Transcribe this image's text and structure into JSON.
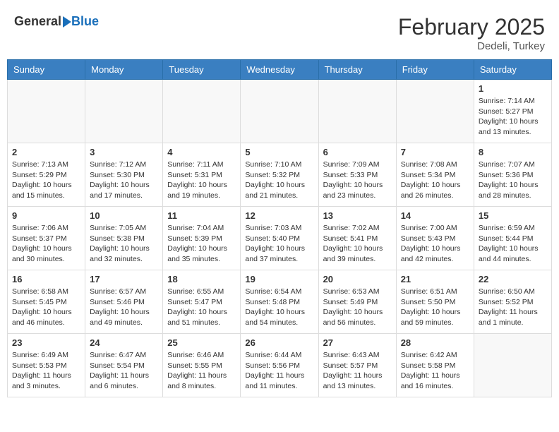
{
  "header": {
    "logo_general": "General",
    "logo_blue": "Blue",
    "month_title": "February 2025",
    "location": "Dedeli, Turkey"
  },
  "days_of_week": [
    "Sunday",
    "Monday",
    "Tuesday",
    "Wednesday",
    "Thursday",
    "Friday",
    "Saturday"
  ],
  "weeks": [
    [
      {
        "day": "",
        "info": ""
      },
      {
        "day": "",
        "info": ""
      },
      {
        "day": "",
        "info": ""
      },
      {
        "day": "",
        "info": ""
      },
      {
        "day": "",
        "info": ""
      },
      {
        "day": "",
        "info": ""
      },
      {
        "day": "1",
        "info": "Sunrise: 7:14 AM\nSunset: 5:27 PM\nDaylight: 10 hours\nand 13 minutes."
      }
    ],
    [
      {
        "day": "2",
        "info": "Sunrise: 7:13 AM\nSunset: 5:29 PM\nDaylight: 10 hours\nand 15 minutes."
      },
      {
        "day": "3",
        "info": "Sunrise: 7:12 AM\nSunset: 5:30 PM\nDaylight: 10 hours\nand 17 minutes."
      },
      {
        "day": "4",
        "info": "Sunrise: 7:11 AM\nSunset: 5:31 PM\nDaylight: 10 hours\nand 19 minutes."
      },
      {
        "day": "5",
        "info": "Sunrise: 7:10 AM\nSunset: 5:32 PM\nDaylight: 10 hours\nand 21 minutes."
      },
      {
        "day": "6",
        "info": "Sunrise: 7:09 AM\nSunset: 5:33 PM\nDaylight: 10 hours\nand 23 minutes."
      },
      {
        "day": "7",
        "info": "Sunrise: 7:08 AM\nSunset: 5:34 PM\nDaylight: 10 hours\nand 26 minutes."
      },
      {
        "day": "8",
        "info": "Sunrise: 7:07 AM\nSunset: 5:36 PM\nDaylight: 10 hours\nand 28 minutes."
      }
    ],
    [
      {
        "day": "9",
        "info": "Sunrise: 7:06 AM\nSunset: 5:37 PM\nDaylight: 10 hours\nand 30 minutes."
      },
      {
        "day": "10",
        "info": "Sunrise: 7:05 AM\nSunset: 5:38 PM\nDaylight: 10 hours\nand 32 minutes."
      },
      {
        "day": "11",
        "info": "Sunrise: 7:04 AM\nSunset: 5:39 PM\nDaylight: 10 hours\nand 35 minutes."
      },
      {
        "day": "12",
        "info": "Sunrise: 7:03 AM\nSunset: 5:40 PM\nDaylight: 10 hours\nand 37 minutes."
      },
      {
        "day": "13",
        "info": "Sunrise: 7:02 AM\nSunset: 5:41 PM\nDaylight: 10 hours\nand 39 minutes."
      },
      {
        "day": "14",
        "info": "Sunrise: 7:00 AM\nSunset: 5:43 PM\nDaylight: 10 hours\nand 42 minutes."
      },
      {
        "day": "15",
        "info": "Sunrise: 6:59 AM\nSunset: 5:44 PM\nDaylight: 10 hours\nand 44 minutes."
      }
    ],
    [
      {
        "day": "16",
        "info": "Sunrise: 6:58 AM\nSunset: 5:45 PM\nDaylight: 10 hours\nand 46 minutes."
      },
      {
        "day": "17",
        "info": "Sunrise: 6:57 AM\nSunset: 5:46 PM\nDaylight: 10 hours\nand 49 minutes."
      },
      {
        "day": "18",
        "info": "Sunrise: 6:55 AM\nSunset: 5:47 PM\nDaylight: 10 hours\nand 51 minutes."
      },
      {
        "day": "19",
        "info": "Sunrise: 6:54 AM\nSunset: 5:48 PM\nDaylight: 10 hours\nand 54 minutes."
      },
      {
        "day": "20",
        "info": "Sunrise: 6:53 AM\nSunset: 5:49 PM\nDaylight: 10 hours\nand 56 minutes."
      },
      {
        "day": "21",
        "info": "Sunrise: 6:51 AM\nSunset: 5:50 PM\nDaylight: 10 hours\nand 59 minutes."
      },
      {
        "day": "22",
        "info": "Sunrise: 6:50 AM\nSunset: 5:52 PM\nDaylight: 11 hours\nand 1 minute."
      }
    ],
    [
      {
        "day": "23",
        "info": "Sunrise: 6:49 AM\nSunset: 5:53 PM\nDaylight: 11 hours\nand 3 minutes."
      },
      {
        "day": "24",
        "info": "Sunrise: 6:47 AM\nSunset: 5:54 PM\nDaylight: 11 hours\nand 6 minutes."
      },
      {
        "day": "25",
        "info": "Sunrise: 6:46 AM\nSunset: 5:55 PM\nDaylight: 11 hours\nand 8 minutes."
      },
      {
        "day": "26",
        "info": "Sunrise: 6:44 AM\nSunset: 5:56 PM\nDaylight: 11 hours\nand 11 minutes."
      },
      {
        "day": "27",
        "info": "Sunrise: 6:43 AM\nSunset: 5:57 PM\nDaylight: 11 hours\nand 13 minutes."
      },
      {
        "day": "28",
        "info": "Sunrise: 6:42 AM\nSunset: 5:58 PM\nDaylight: 11 hours\nand 16 minutes."
      },
      {
        "day": "",
        "info": ""
      }
    ]
  ]
}
